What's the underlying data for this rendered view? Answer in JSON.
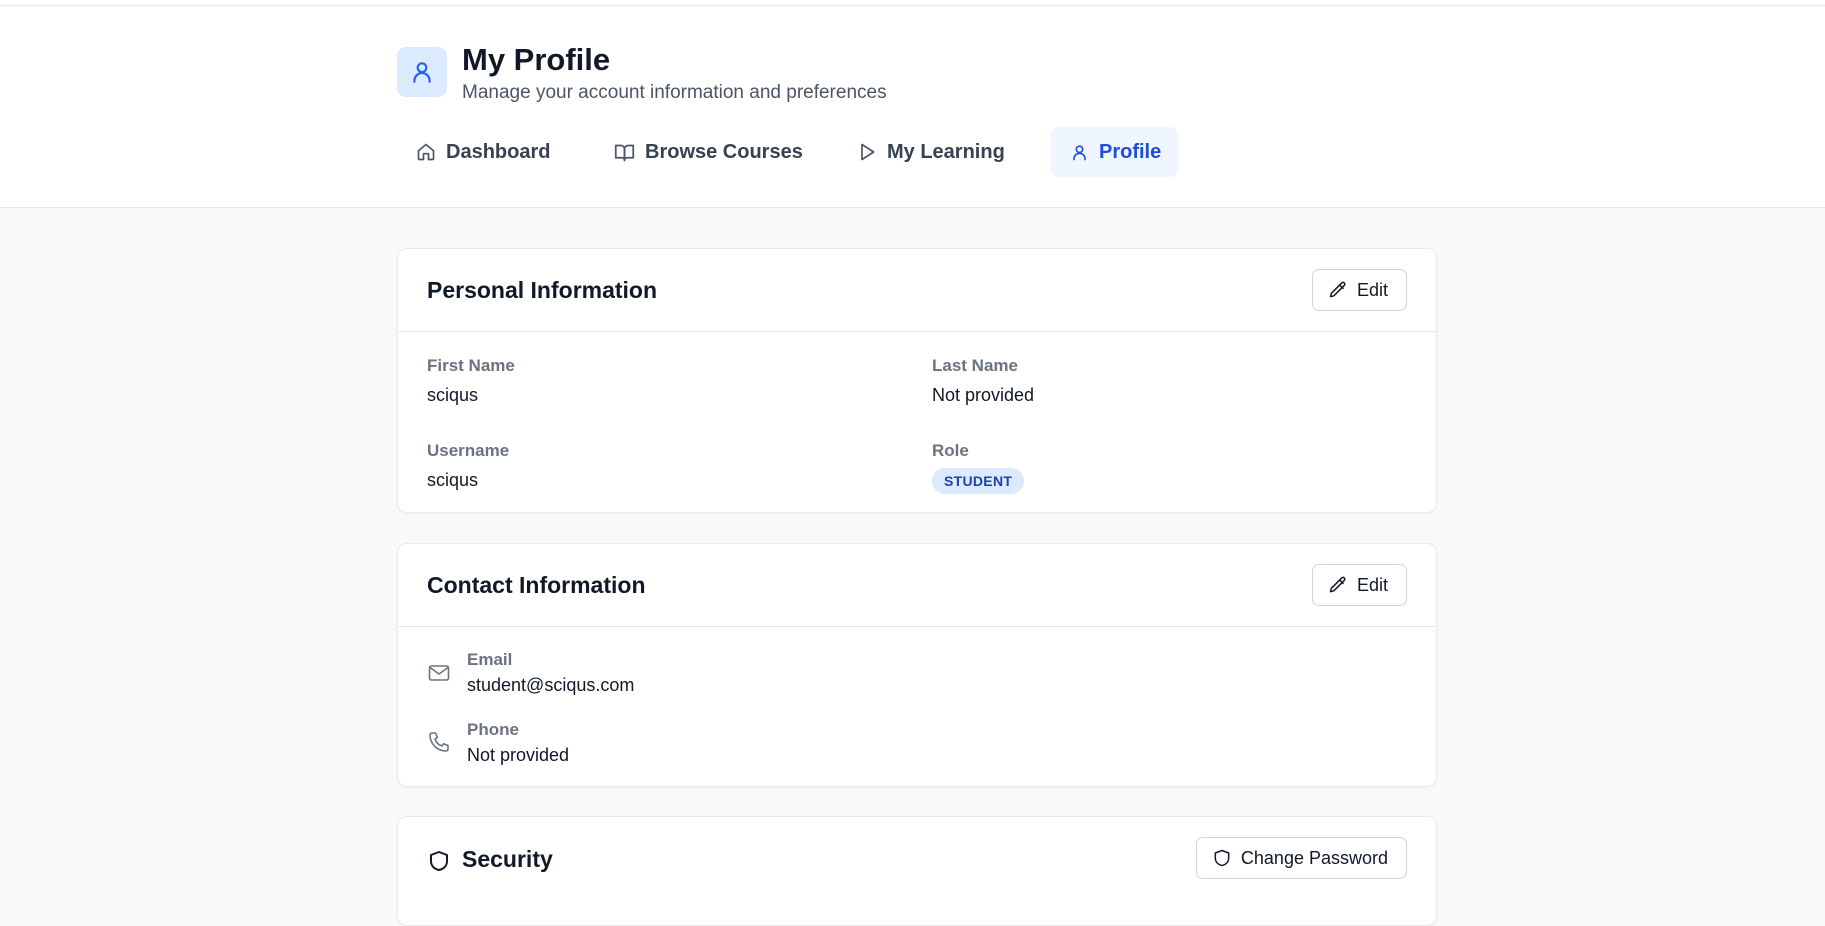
{
  "header": {
    "title": "My Profile",
    "subtitle": "Manage your account information and preferences",
    "avatar_icon": "user-icon",
    "accent_color": "#1d4ed8"
  },
  "nav": {
    "items": [
      {
        "label": "Dashboard",
        "icon": "home-icon",
        "active": false
      },
      {
        "label": "Browse Courses",
        "icon": "book-open-icon",
        "active": false
      },
      {
        "label": "My Learning",
        "icon": "play-icon",
        "active": false
      },
      {
        "label": "Profile",
        "icon": "user-icon",
        "active": true
      }
    ]
  },
  "personal_info": {
    "title": "Personal Information",
    "edit_label": "Edit",
    "first_name_label": "First Name",
    "first_name_value": "sciqus",
    "last_name_label": "Last Name",
    "last_name_value": "Not provided",
    "username_label": "Username",
    "username_value": "sciqus",
    "role_label": "Role",
    "role_value": "STUDENT"
  },
  "contact_info": {
    "title": "Contact Information",
    "edit_label": "Edit",
    "email_label": "Email",
    "email_value": "student@sciqus.com",
    "phone_label": "Phone",
    "phone_value": "Not provided"
  },
  "security": {
    "title": "Security",
    "change_password_label": "Change Password"
  }
}
